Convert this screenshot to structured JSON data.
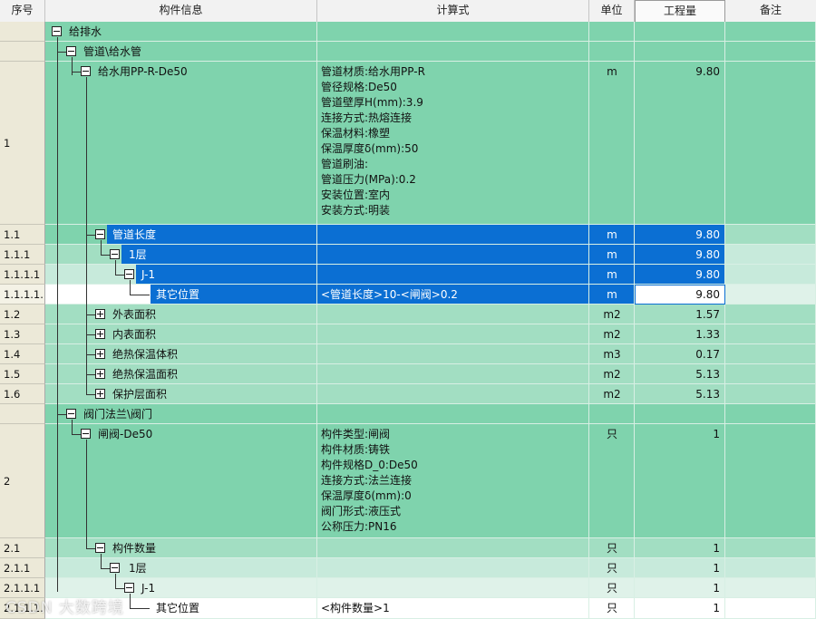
{
  "header": {
    "seq": "序号",
    "name": "构件信息",
    "formula": "计算式",
    "unit": "单位",
    "qty": "工程量",
    "note": "备注"
  },
  "rows": [
    {
      "seq": "",
      "name": "给排水",
      "formula": "",
      "unit": "",
      "qty": ""
    },
    {
      "seq": "",
      "name": "管道\\给水管",
      "formula": "",
      "unit": "",
      "qty": ""
    },
    {
      "seq": "1",
      "name": "给水用PP-R-De50",
      "formula_lines": [
        "管道材质:给水用PP-R",
        "管径规格:De50",
        "管道壁厚H(mm):3.9",
        "连接方式:热熔连接",
        "保温材料:橡塑",
        "保温厚度δ(mm):50",
        "管道刷油:",
        "管道压力(MPa):0.2",
        "安装位置:室内",
        "安装方式:明装"
      ],
      "unit": "m",
      "qty": "9.80"
    },
    {
      "seq": "1.1",
      "name": "管道长度",
      "formula": "",
      "unit": "m",
      "qty": "9.80"
    },
    {
      "seq": "1.1.1",
      "name": "1层",
      "formula": "",
      "unit": "m",
      "qty": "9.80"
    },
    {
      "seq": "1.1.1.1",
      "name": "J-1",
      "formula": "",
      "unit": "m",
      "qty": "9.80"
    },
    {
      "seq": "1.1.1.1.",
      "name": "其它位置",
      "formula": "<管道长度>10-<闸阀>0.2",
      "unit": "m",
      "qty": "9.80"
    },
    {
      "seq": "1.2",
      "name": "外表面积",
      "formula": "",
      "unit": "m2",
      "qty": "1.57"
    },
    {
      "seq": "1.3",
      "name": "内表面积",
      "formula": "",
      "unit": "m2",
      "qty": "1.33"
    },
    {
      "seq": "1.4",
      "name": "绝热保温体积",
      "formula": "",
      "unit": "m3",
      "qty": "0.17"
    },
    {
      "seq": "1.5",
      "name": "绝热保温面积",
      "formula": "",
      "unit": "m2",
      "qty": "5.13"
    },
    {
      "seq": "1.6",
      "name": "保护层面积",
      "formula": "",
      "unit": "m2",
      "qty": "5.13"
    },
    {
      "seq": "",
      "name": "阀门法兰\\阀门",
      "formula": "",
      "unit": "",
      "qty": ""
    },
    {
      "seq": "2",
      "name": "闸阀-De50",
      "formula_lines": [
        "构件类型:闸阀",
        "构件材质:铸铁",
        "构件规格D_0:De50",
        "连接方式:法兰连接",
        "保温厚度δ(mm):0",
        "阀门形式:液压式",
        "公称压力:PN16"
      ],
      "unit": "只",
      "qty": "1"
    },
    {
      "seq": "2.1",
      "name": "构件数量",
      "formula": "",
      "unit": "只",
      "qty": "1"
    },
    {
      "seq": "2.1.1",
      "name": "1层",
      "formula": "",
      "unit": "只",
      "qty": "1"
    },
    {
      "seq": "2.1.1.1",
      "name": "J-1",
      "formula": "",
      "unit": "只",
      "qty": "1"
    },
    {
      "seq": "2.1.1.1.",
      "name": "其它位置",
      "formula": "<构件数量>1",
      "unit": "只",
      "qty": "1"
    }
  ],
  "colors": {
    "green_dark": "#7fd3ad",
    "green_mid": "#a2dec2",
    "green_light": "#c7eadb",
    "selected": "#0b6fd3",
    "seq_col": "#ece9d8"
  },
  "watermark": "CSDN 大数跨境"
}
